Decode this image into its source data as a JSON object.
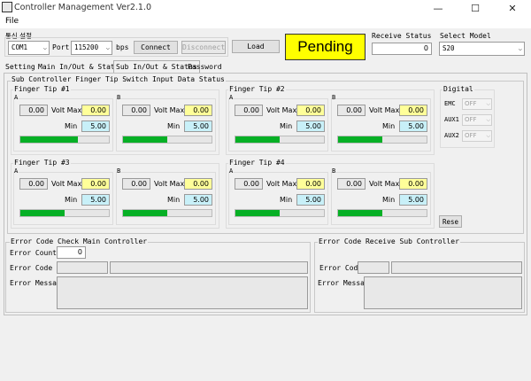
{
  "window": {
    "title": "Controller Management Ver2.1.0",
    "minimize": "—",
    "maximize": "☐",
    "close": "✕"
  },
  "menu": {
    "file": "File"
  },
  "comm": {
    "group_label": "통신 설정",
    "com_port_value": "COM1",
    "port_label": "Port",
    "baud_value": "115200",
    "bps_label": "bps",
    "connect_label": "Connect",
    "disconnect_label": "Disconnect",
    "load_label": "Load"
  },
  "status": {
    "pending_text": "Pending",
    "receive_label": "Receive Status",
    "receive_value": "0",
    "pending_color": "#ffff00"
  },
  "model": {
    "label": "Select Model",
    "value": "S20"
  },
  "tabs": [
    {
      "label": "Setting"
    },
    {
      "label": "Main In/Out & Status"
    },
    {
      "label": "Sub In/Out & Status"
    },
    {
      "label": "Password"
    }
  ],
  "sub_panel": {
    "title": "Sub Controller Finger Tip Switch Input Data Status",
    "fingers": [
      {
        "title": "Finger Tip #1",
        "a": {
          "label": "A",
          "value": "0.00",
          "volt_max_label": "Volt Max",
          "volt_max": "0.00",
          "min_label": "Min",
          "min": "5.00",
          "progress": 0.65
        },
        "b": {
          "label": "B",
          "value": "0.00",
          "volt_max_label": "Volt Max",
          "volt_max": "0.00",
          "min_label": "Min",
          "min": "5.00",
          "progress": 0.5
        }
      },
      {
        "title": "Finger Tip #2",
        "a": {
          "label": "A",
          "value": "0.00",
          "volt_max_label": "Volt Max",
          "volt_max": "0.00",
          "min_label": "Min",
          "min": "5.00",
          "progress": 0.5
        },
        "b": {
          "label": "B",
          "value": "0.00",
          "volt_max_label": "Volt Max",
          "volt_max": "0.00",
          "min_label": "Min",
          "min": "5.00",
          "progress": 0.5
        }
      },
      {
        "title": "Finger Tip #3",
        "a": {
          "label": "A",
          "value": "0.00",
          "volt_max_label": "Volt Max",
          "volt_max": "0.00",
          "min_label": "Min",
          "min": "5.00",
          "progress": 0.5
        },
        "b": {
          "label": "B",
          "value": "0.00",
          "volt_max_label": "Volt Max",
          "volt_max": "0.00",
          "min_label": "Min",
          "min": "5.00",
          "progress": 0.5
        }
      },
      {
        "title": "Finger Tip #4",
        "a": {
          "label": "A",
          "value": "0.00",
          "volt_max_label": "Volt Max",
          "volt_max": "0.00",
          "min_label": "Min",
          "min": "5.00",
          "progress": 0.5
        },
        "b": {
          "label": "B",
          "value": "0.00",
          "volt_max_label": "Volt Max",
          "volt_max": "0.00",
          "min_label": "Min",
          "min": "5.00",
          "progress": 0.5
        }
      }
    ],
    "digital": {
      "title": "Digital",
      "items": [
        {
          "label": "EMC",
          "value": "OFF"
        },
        {
          "label": "AUX1",
          "value": "OFF"
        },
        {
          "label": "AUX2",
          "value": "OFF"
        }
      ]
    },
    "reset_label": "Rese"
  },
  "error_main": {
    "title": "Error Code Check Main Controller",
    "count_label": "Error Count",
    "count_value": "0",
    "code_label": "Error Code",
    "message_label": "Error Message"
  },
  "error_sub": {
    "title": "Error Code Receive Sub Controller",
    "code_label": "Error Code",
    "message_label": "Error Message"
  },
  "colors": {
    "progress_fill": "#06b025",
    "yellow_field": "#ffff99",
    "cyan_field": "#c8f0f8"
  }
}
